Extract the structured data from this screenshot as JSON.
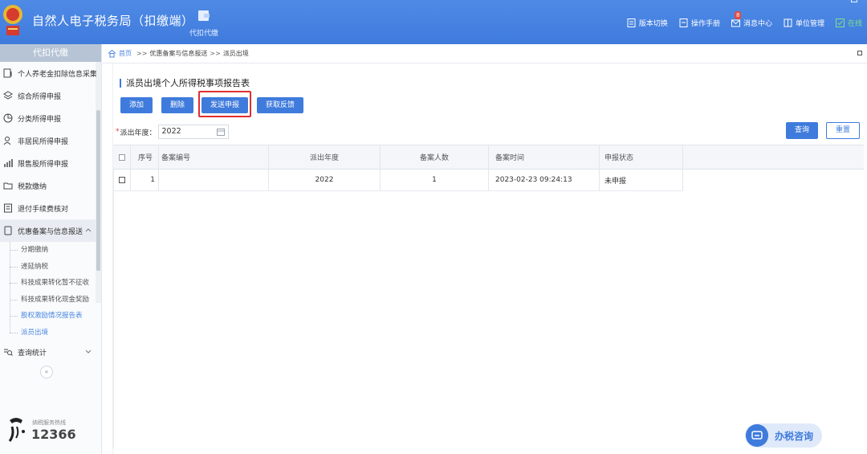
{
  "header": {
    "app_title": "自然人电子税务局（扣缴端）",
    "module_tab": {
      "label": "代扣代缴",
      "icon": "wallet-icon"
    },
    "actions": [
      {
        "label": "版本切换",
        "icon": "doc-icon"
      },
      {
        "label": "操作手册",
        "icon": "manual-icon"
      },
      {
        "label": "消息中心",
        "icon": "mail-icon",
        "badge": "8"
      },
      {
        "label": "单位管理",
        "icon": "building-icon"
      },
      {
        "label": "在线",
        "icon": "online-check-icon"
      }
    ],
    "colors": {
      "bar": "#3f7bdc",
      "online": "#7de08a",
      "badge": "#e64a3b"
    }
  },
  "sidebar": {
    "title": "代扣代缴",
    "items": [
      {
        "label": "个人养老金扣除信息采集",
        "icon": "pension-icon"
      },
      {
        "label": "综合所得申报",
        "icon": "layers-icon"
      },
      {
        "label": "分类所得申报",
        "icon": "pie-icon"
      },
      {
        "label": "非居民所得申报",
        "icon": "person-icon"
      },
      {
        "label": "限售股所得申报",
        "icon": "bar-chart-icon"
      },
      {
        "label": "税款缴纳",
        "icon": "folder-icon"
      },
      {
        "label": "退付手续费核对",
        "icon": "receipt-icon"
      },
      {
        "label": "优惠备案与信息报送",
        "icon": "document-icon"
      }
    ],
    "sub_items": [
      {
        "label": "分期缴纳"
      },
      {
        "label": "递延纳税"
      },
      {
        "label": "科技成果转化暂不征收"
      },
      {
        "label": "科技成果转化现金奖励"
      },
      {
        "label": "股权激励情况报告表"
      },
      {
        "label": "派员出境"
      }
    ],
    "stats_item": {
      "label": "查询统计",
      "icon": "search-list-icon"
    },
    "collapse_glyph": "«",
    "hotline": {
      "label": "纳税服务热线",
      "number": "12366"
    }
  },
  "breadcrumb": {
    "home": "首页",
    "separator": ">>",
    "path": [
      "优惠备案与信息报送",
      "派员出境"
    ]
  },
  "main": {
    "title": "派员出境个人所得税事项报告表",
    "buttons": {
      "add": "添加",
      "delete": "删除",
      "send": "发送申报",
      "feedback": "获取反馈"
    },
    "filter": {
      "required_mark": "*",
      "label": "派出年度：",
      "value": "2022"
    },
    "query": "查询",
    "reset": "重置",
    "table": {
      "headers": [
        "序号",
        "备案编号",
        "派出年度",
        "备案人数",
        "备案时间",
        "申报状态"
      ],
      "rows": [
        {
          "seq": "1",
          "code": "",
          "year": "2022",
          "count": "1",
          "time": "2023-02-23 09:24:13",
          "status": "未申报"
        }
      ]
    }
  },
  "consult": {
    "label": "办税咨询"
  }
}
